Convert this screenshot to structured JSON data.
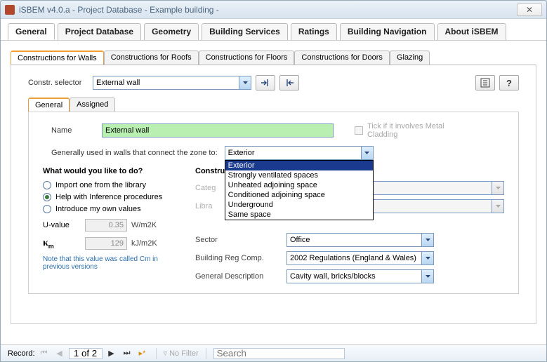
{
  "window": {
    "title": "iSBEM v4.0.a - Project Database - Example building -"
  },
  "main_tabs": [
    "General",
    "Project Database",
    "Geometry",
    "Building Services",
    "Ratings",
    "Building Navigation",
    "About iSBEM"
  ],
  "main_tab_active": 0,
  "sub_tabs": [
    "Constructions for Walls",
    "Constructions for Roofs",
    "Constructions for Floors",
    "Constructions for Doors",
    "Glazing"
  ],
  "sub_tab_active": 0,
  "selector": {
    "label": "Constr. selector",
    "value": "External wall"
  },
  "inner_tabs": [
    "General",
    "Assigned"
  ],
  "inner_tab_active": 0,
  "form": {
    "name_label": "Name",
    "name_value": "External wall",
    "cladding_label": "Tick if it involves Metal Cladding",
    "zone_label": "Generally used in walls that connect the zone to:",
    "zone_value": "Exterior",
    "zone_options": [
      "Exterior",
      "Strongly ventilated spaces",
      "Unheated adjoining space",
      "Conditioned adjoining space",
      "Underground",
      "Same space"
    ]
  },
  "left": {
    "heading": "What would you like to do?",
    "radios": [
      "Import one from the library",
      "Help with Inference procedures",
      "Introduce my own values"
    ],
    "radio_selected": 1,
    "uvalue_label": "U-value",
    "uvalue": "0.35",
    "uvalue_unit": "W/m2K",
    "km_value": "129",
    "km_unit": "kJ/m2K",
    "note": "Note that this value was called Cm in previous versions"
  },
  "right": {
    "heading": "Construc",
    "category_label": "Categ",
    "library_label": "Libra",
    "sector_label": "Sector",
    "sector_value": "Office",
    "breg_label": "Building Reg Comp.",
    "breg_value": "2002 Regulations (England & Wales)",
    "desc_label": "General Description",
    "desc_value": "Cavity wall, bricks/blocks"
  },
  "recordbar": {
    "label": "Record:",
    "pos": "1 of 2",
    "nofilter": "No Filter",
    "search": "Search"
  }
}
